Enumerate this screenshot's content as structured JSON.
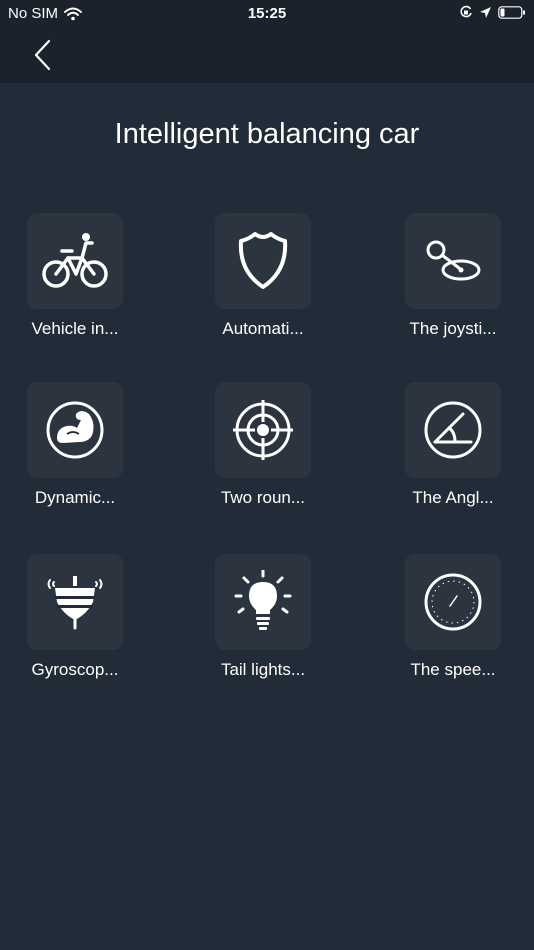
{
  "status_bar": {
    "carrier": "No SIM",
    "time": "15:25"
  },
  "page_title": "Intelligent balancing car",
  "items": [
    {
      "label": "Vehicle in...",
      "icon": "bicycle-icon"
    },
    {
      "label": "Automati...",
      "icon": "shield-icon"
    },
    {
      "label": "The joysti...",
      "icon": "joystick-icon"
    },
    {
      "label": "Dynamic...",
      "icon": "muscle-arm-icon"
    },
    {
      "label": "Two roun...",
      "icon": "target-icon"
    },
    {
      "label": "The Angl...",
      "icon": "angle-icon"
    },
    {
      "label": "Gyroscop...",
      "icon": "gyroscope-icon"
    },
    {
      "label": "Tail lights...",
      "icon": "lightbulb-icon"
    },
    {
      "label": "The spee...",
      "icon": "speedometer-icon"
    }
  ]
}
